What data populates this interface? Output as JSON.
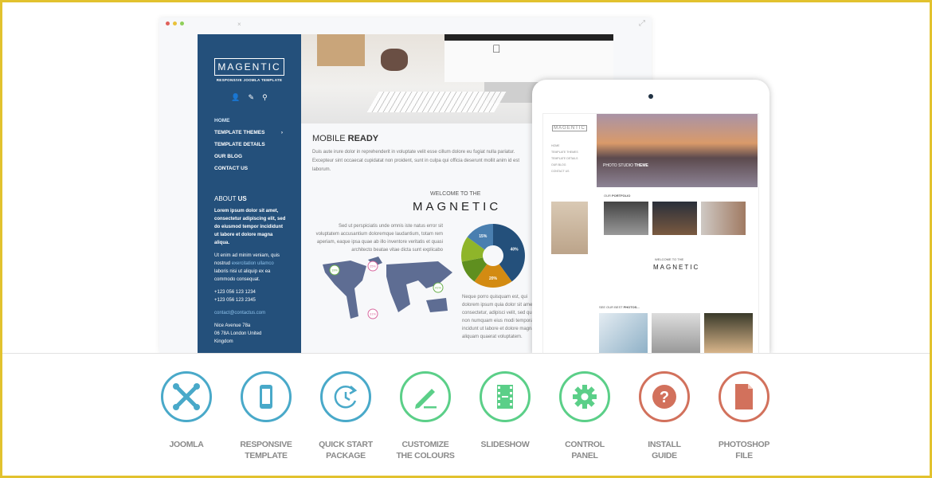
{
  "browser": {
    "close_glyph": "×",
    "expand_glyph": "⤢",
    "dot_colors": [
      "#e0605a",
      "#e9c23a",
      "#8fcf5a"
    ]
  },
  "sidebar": {
    "logo": "MAGENTIC",
    "logo_sub": "RESPONSIVE JOOMLA TEMPLATE",
    "icons": [
      "user-icon",
      "pencil-icon",
      "search-icon"
    ],
    "nav": [
      {
        "label": "HOME",
        "active": true
      },
      {
        "label": "TEMPLATE THEMES",
        "submenu": true
      },
      {
        "label": "TEMPLATE DETAILS"
      },
      {
        "label": "OUR BLOG"
      },
      {
        "label": "CONTACT US"
      }
    ],
    "about_light": "ABOUT ",
    "about_bold": "US",
    "about_text": "Lorem ipsum dolor sit amet, consectetur adipiscing elit, sed do eiusmod tempor incididunt ut labore et dolore magna aliqua.",
    "text2_a": "Ut enim ad minim veniam, quis nostrud ",
    "text2_link": "exercitation ullamco",
    "text2_b": " laboris nisi ut aliquip ex ea commodo consequat.",
    "phone1": "+123 056 123 1234",
    "phone2": "+123 056 123 2345",
    "email": "contact@contactus.com",
    "address1": "Nice Avenue 78a",
    "address2": "06 78A London United",
    "address3": "Kingdom",
    "bg_color": "#24507b"
  },
  "main": {
    "mobile_light": "MOBILE ",
    "mobile_bold": "READY",
    "mobile_text": "Duis aute irure dolor in reprehenderit in voluptate velit esse cillum dolore eu fugiat nulla pariatur. Excepteur sint occaecat cupidatat non proident, sunt in culpa qui officia deserunt mollit anim id est laborum.",
    "welcome": "WELCOME TO THE",
    "title": "MAGNETIC",
    "para1": "Sed ut perspiciatis unde omnis iste natus error sit voluptatem accusantium doloremque laudantium, totam rem aperiam, eaque ipsa quae ab illo inventore veritatis et quasi architecto beatae vitae dicta sunt explicabo",
    "para2": "Neque porro quisquam est, qui dolorem ipsum quia dolor sit amet, consectetur, adipisci velit, sed quia non numquam eius modi tempora incidunt ut labore et dolore magnam aliquam quaerat voluptatem.",
    "map_pins": [
      {
        "label": "19%",
        "color": "#6ab04c"
      },
      {
        "label": "25%",
        "color": "#d96aa0"
      },
      {
        "label": "31%",
        "color": "#d96aa0"
      },
      {
        "label": "41%",
        "color": "#6ab04c"
      }
    ],
    "donut": [
      {
        "label": "40%",
        "value": 40,
        "color": "#24507b"
      },
      {
        "label": "20%",
        "value": 20,
        "color": "#d38b12"
      },
      {
        "label": "",
        "value": 12,
        "color": "#5f8f1f"
      },
      {
        "label": "",
        "value": 13,
        "color": "#8fb52a"
      },
      {
        "label": "15%",
        "value": 15,
        "color": "#4a7fb0"
      }
    ]
  },
  "tablet": {
    "logo": "MAGENTIC",
    "nav": [
      "HOME",
      "TEMPLATE THEMES",
      "TEMPLATE DETAILS",
      "OUR BLOG",
      "CONTACT US"
    ],
    "slide_light": "PHOTO STUDIO ",
    "slide_bold": "THEME",
    "portfolio_light": "OUR ",
    "portfolio_bold": "PORTFOLIO",
    "welcome": "WELCOME TO THE",
    "title": "MAGNETIC",
    "photos_light": "SEE OUR BEST ",
    "photos_bold": "PHOTOS..."
  },
  "features": [
    {
      "icon": "joomla-icon",
      "label": "JOOMLA",
      "color": "#49a9c9"
    },
    {
      "icon": "smartphone-icon",
      "label": "RESPONSIVE\nTEMPLATE",
      "color": "#49a9c9"
    },
    {
      "icon": "clock-refresh-icon",
      "label": "QUICK START\nPACKAGE",
      "color": "#49a9c9"
    },
    {
      "icon": "pencil-icon",
      "label": "CUSTOMIZE\nTHE COLOURS",
      "color": "#5bcf88"
    },
    {
      "icon": "film-icon",
      "label": "SLIDESHOW",
      "color": "#5bcf88"
    },
    {
      "icon": "gear-icon",
      "label": "CONTROL\nPANEL",
      "color": "#5bcf88"
    },
    {
      "icon": "question-icon",
      "label": "INSTALL\nGUIDE",
      "color": "#d2715c"
    },
    {
      "icon": "file-icon",
      "label": "PHOTOSHOP\nFILE",
      "color": "#d2715c"
    }
  ]
}
